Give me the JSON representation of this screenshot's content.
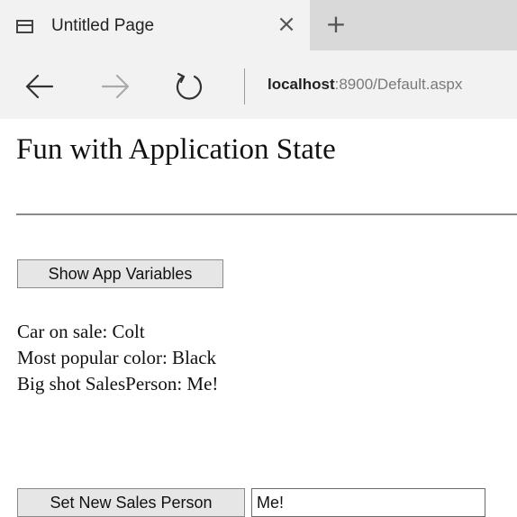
{
  "browser": {
    "tab_title": "Untitled Page",
    "tab_close_glyph": "×",
    "new_tab_glyph": "+",
    "address_host": "localhost",
    "address_rest": ":8900/Default.aspx",
    "icons": [
      "tab-page-icon",
      "back-arrow-icon",
      "forward-arrow-icon",
      "refresh-icon"
    ]
  },
  "page": {
    "title": "Fun with Application State",
    "show_button_label": "Show App Variables",
    "info_lines": [
      "Car on sale: Colt",
      "Most popular color: Black",
      "Big shot SalesPerson: Me!"
    ],
    "set_button_label": "Set New Sales Person",
    "salesperson_input_value": "Me!"
  }
}
